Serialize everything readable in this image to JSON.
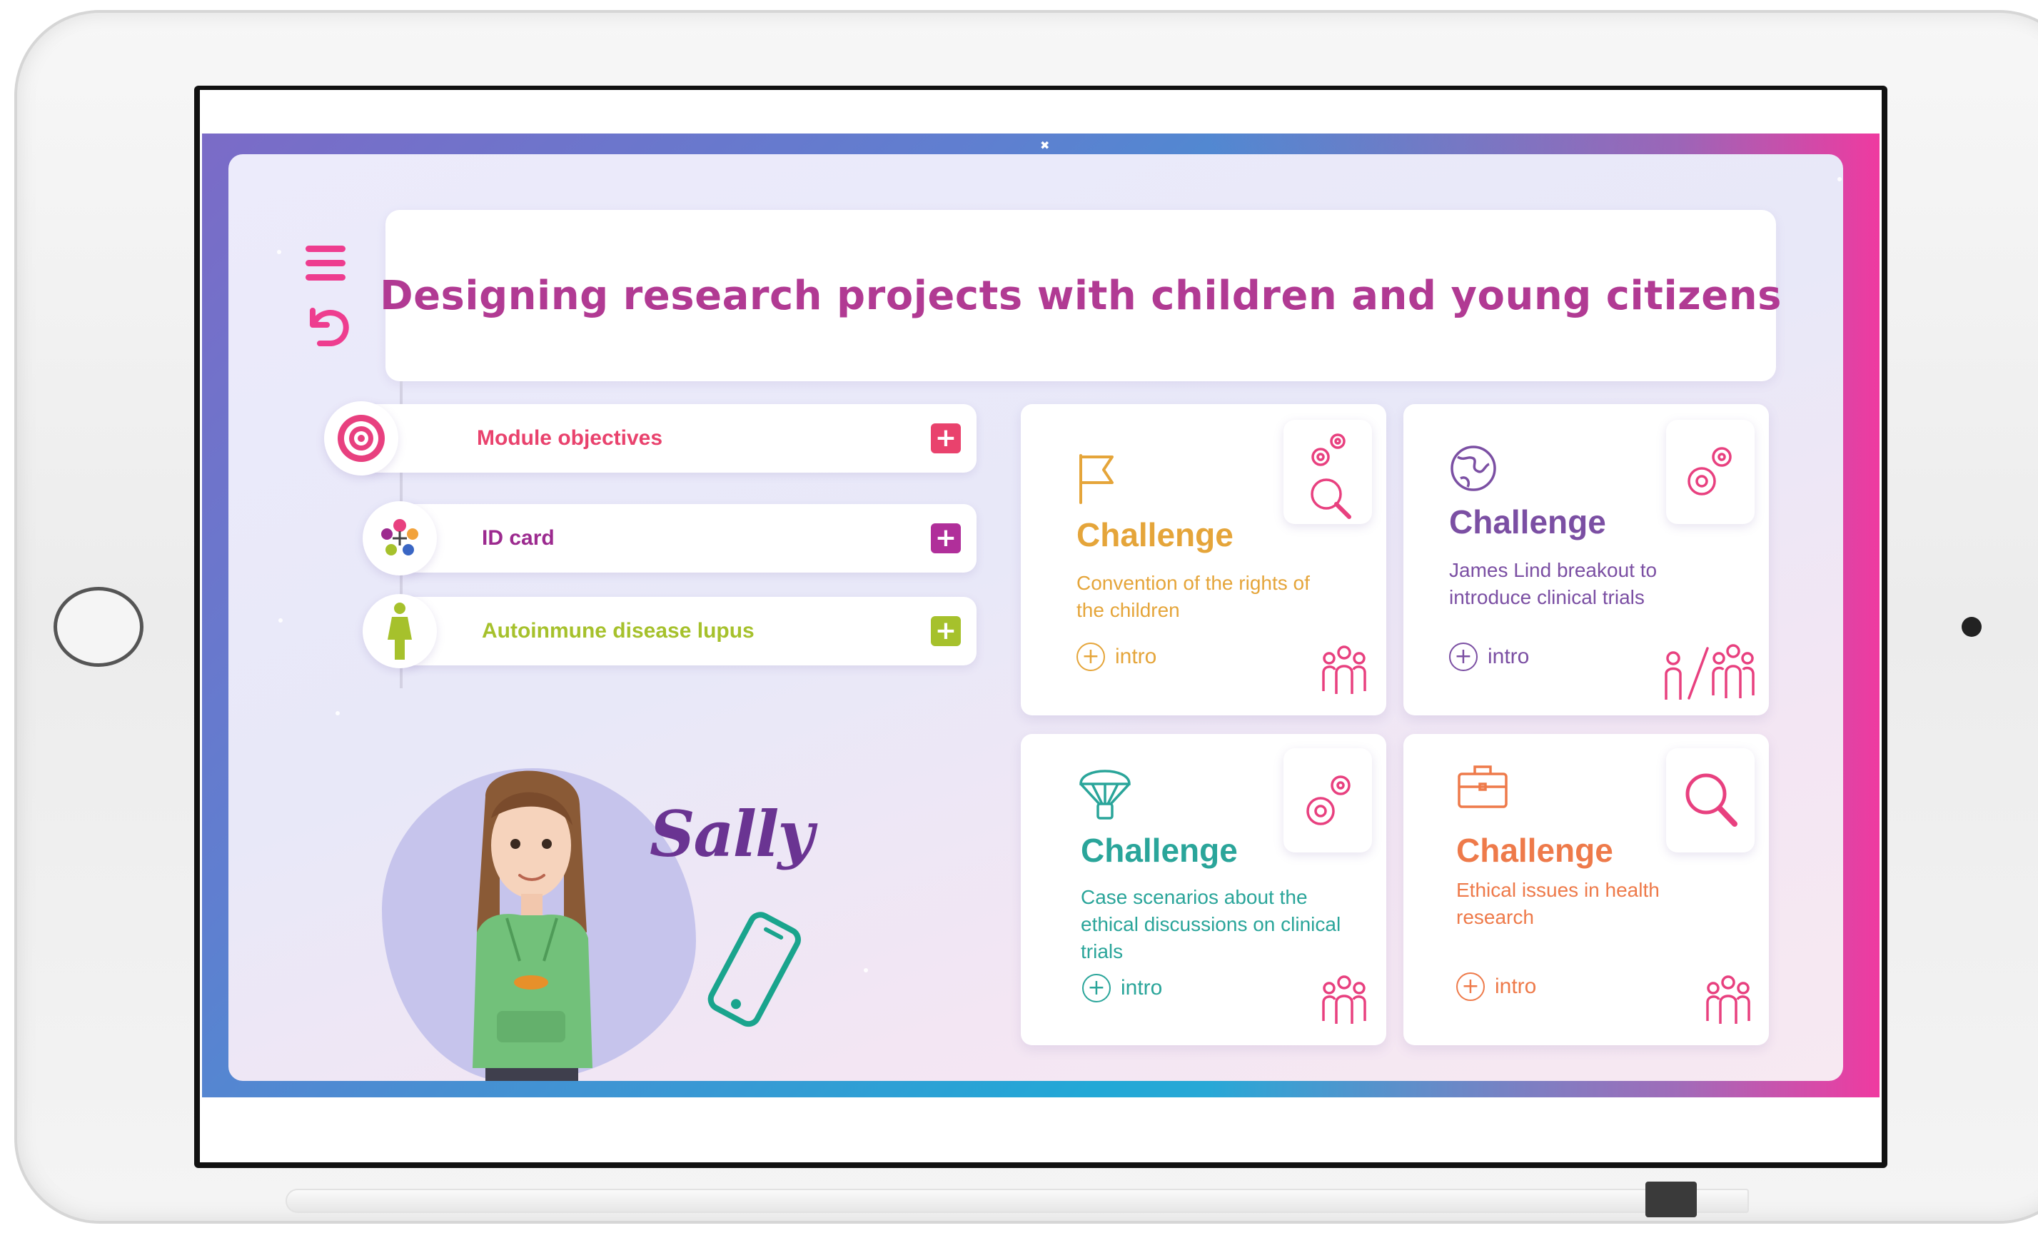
{
  "title": "Designing research projects with children and young citizens",
  "left_items": [
    {
      "label": "Module objectives",
      "color": "#e9426d",
      "icon": "target-icon"
    },
    {
      "label": "ID card",
      "color": "#9c2a8f",
      "icon": "puzzle-people-icon"
    },
    {
      "label": "Autoinmune disease lupus",
      "color": "#a6c12c",
      "icon": "person-icon"
    }
  ],
  "plus_symbol": "+",
  "character_name": "Sally",
  "cards": [
    {
      "title": "Challenge",
      "description": "Convention of the rights of the children",
      "intro": "intro",
      "color": "#e5a53a",
      "icon": "flag-icon",
      "badge_icon": "gears-search-icon",
      "footer_icon": "group-icon"
    },
    {
      "title": "Challenge",
      "description": "James Lind breakout to introduce clinical trials",
      "intro": "intro",
      "color": "#7b4fa3",
      "icon": "globe-icon",
      "badge_icon": "gears-icon",
      "footer_icon": "person-group-icon"
    },
    {
      "title": "Challenge",
      "description": "Case scenarios about the ethical discussions on clinical trials",
      "intro": "intro",
      "color": "#2aa59a",
      "icon": "parachute-icon",
      "badge_icon": "gears-icon",
      "footer_icon": "group-icon"
    },
    {
      "title": "Challenge",
      "description": "Ethical issues in health research",
      "intro": "intro",
      "color": "#ee7a4a",
      "icon": "briefcase-icon",
      "badge_icon": "search-icon",
      "footer_icon": "group-icon"
    }
  ],
  "intro_symbol": "+",
  "theme": {
    "accent_pink": "#ee3d8f",
    "title_color": "#b13a93",
    "icon_pink": "#e8407f"
  }
}
